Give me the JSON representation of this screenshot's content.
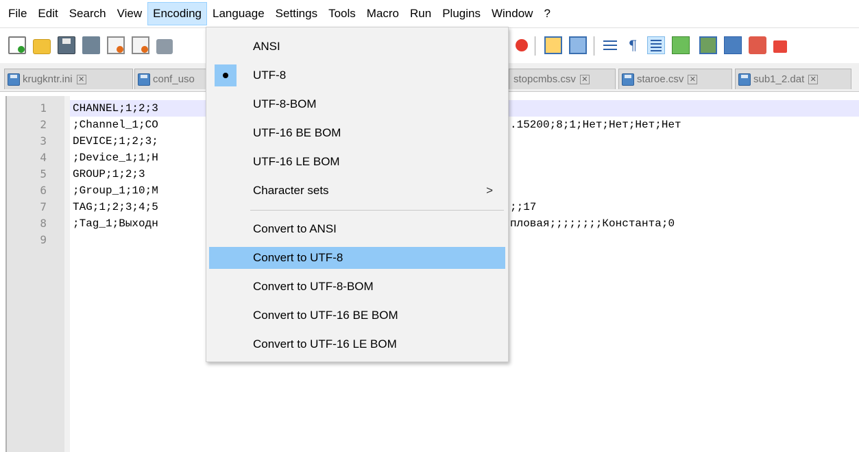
{
  "menubar": {
    "items": [
      "File",
      "Edit",
      "Search",
      "View",
      "Encoding",
      "Language",
      "Settings",
      "Tools",
      "Macro",
      "Run",
      "Plugins",
      "Window",
      "?"
    ],
    "active": "Encoding"
  },
  "tabs": [
    {
      "label": "krugkntr.ini"
    },
    {
      "label": "conf_uso"
    },
    {
      "label": "stopcmbs.csv"
    },
    {
      "label": "staroe.csv"
    },
    {
      "label": "sub1_2.dat"
    }
  ],
  "editor": {
    "line_numbers": [
      "1",
      "2",
      "3",
      "4",
      "5",
      "6",
      "7",
      "8",
      "9"
    ],
    "lines": [
      {
        "left": "CHANNEL;1;2;3",
        "right": ""
      },
      {
        "left": ";Channel_1;CO",
        "right": ".15200;8;1;Нет;Нет;Нет;Нет"
      },
      {
        "left": "DEVICE;1;2;3;",
        "right": ""
      },
      {
        "left": ";Device_1;1;H",
        "right": ""
      },
      {
        "left": "GROUP;1;2;3",
        "right": ""
      },
      {
        "left": ";Group_1;10;M",
        "right": ""
      },
      {
        "left": "TAG;1;2;3;4;5",
        "right": ";;17"
      },
      {
        "left": ";Tag_1;Выходн",
        "right": "пловая;;;;;;;;Константа;0"
      },
      {
        "left": "",
        "right": ""
      }
    ]
  },
  "encoding_menu": {
    "items": [
      {
        "label": "ANSI"
      },
      {
        "label": "UTF-8",
        "checked": true
      },
      {
        "label": "UTF-8-BOM"
      },
      {
        "label": "UTF-16 BE BOM"
      },
      {
        "label": "UTF-16 LE BOM"
      },
      {
        "label": "Character sets",
        "submenu_arrow": ">"
      },
      {
        "label": "Convert to ANSI"
      },
      {
        "label": "Convert to UTF-8",
        "hovered": true
      },
      {
        "label": "Convert to UTF-8-BOM"
      },
      {
        "label": "Convert to UTF-16 BE BOM"
      },
      {
        "label": "Convert to UTF-16 LE BOM"
      }
    ]
  },
  "toolbar": {
    "icons": [
      "new-file-icon",
      "open-folder-icon",
      "save-icon",
      "save-all-icon",
      "close-icon",
      "close-all-icon",
      "print-icon",
      "find-icon",
      "sync-vertical-icon",
      "sync-horizontal-icon",
      "word-wrap-icon",
      "show-all-chars-icon",
      "indent-guide-icon",
      "user-defined-language-icon",
      "document-map-icon",
      "document-list-icon",
      "function-list-icon",
      "folder-workspace-icon"
    ]
  },
  "colors": {
    "menu_active_bg": "#cce8ff",
    "dropdown_hover": "#91c9f7",
    "current_line": "#e8e8ff",
    "gutter_bg": "#e4e4e4"
  }
}
